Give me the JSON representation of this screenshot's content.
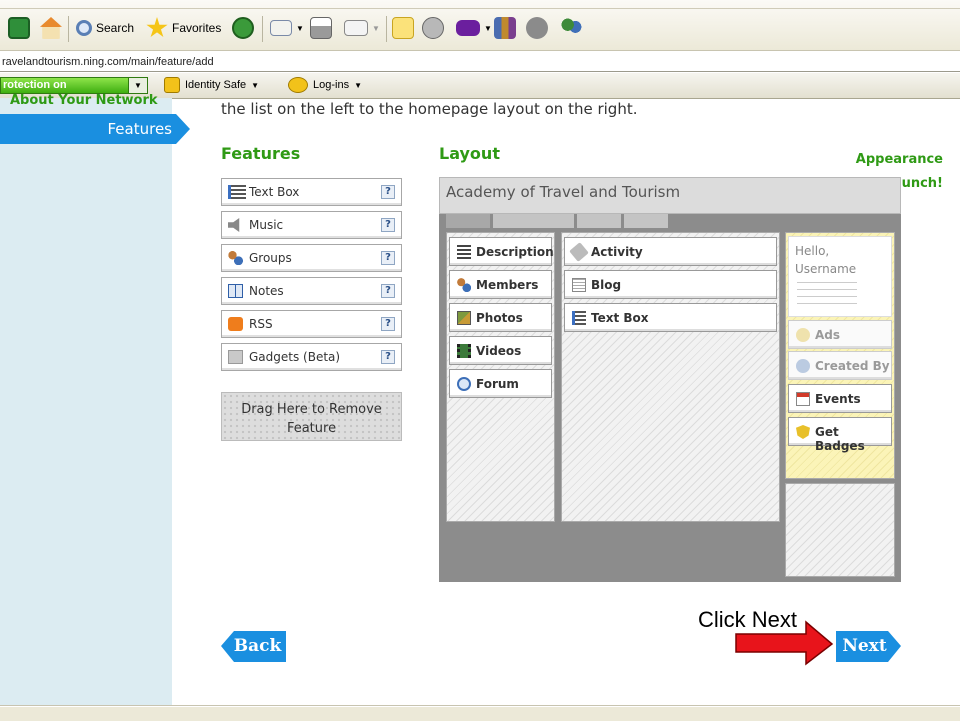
{
  "browser": {
    "toolbar": {
      "search_label": "Search",
      "favorites_label": "Favorites"
    },
    "address": "ravelandtourism.ning.com/main/feature/add",
    "norton": {
      "protection_label": "rotection on",
      "identity_safe_label": "Identity Safe",
      "logins_label": "Log-ins"
    }
  },
  "sidebar": {
    "top_partial": "About Your Network",
    "active_item": "Features",
    "items": [
      "Appearance",
      "Launch!"
    ]
  },
  "main": {
    "intro_text": "the list on the left to the homepage layout on the right.",
    "features_heading": "Features",
    "layout_heading": "Layout",
    "features": [
      {
        "label": "Text Box",
        "icon": "text-box-icon"
      },
      {
        "label": "Music",
        "icon": "speaker-icon"
      },
      {
        "label": "Groups",
        "icon": "groups-icon"
      },
      {
        "label": "Notes",
        "icon": "book-icon"
      },
      {
        "label": "RSS",
        "icon": "rss-icon"
      },
      {
        "label": "Gadgets (Beta)",
        "icon": "gadget-icon"
      }
    ],
    "help_symbol": "?",
    "drop_zone_label": "Drag Here to Remove Feature"
  },
  "layout_preview": {
    "title": "Academy of Travel and Tourism",
    "left_column": [
      "Description",
      "Members",
      "Photos",
      "Videos",
      "Forum"
    ],
    "center_column": [
      "Activity",
      "Blog",
      "Text Box"
    ],
    "profile_greeting": "Hello,",
    "profile_username": "Username",
    "right_column": [
      {
        "label": "Ads",
        "faded": true
      },
      {
        "label": "Created By",
        "faded": true
      },
      {
        "label": "Events",
        "faded": false
      },
      {
        "label": "Get Badges",
        "faded": false
      }
    ]
  },
  "buttons": {
    "back": "Back",
    "next": "Next"
  },
  "annotation": {
    "text": "Click Next",
    "arrow_color": "#e8141b"
  },
  "colors": {
    "accent_blue": "#1a8fe0",
    "heading_green": "#2f9a15",
    "sidebar_bg": "#dcecf2"
  }
}
